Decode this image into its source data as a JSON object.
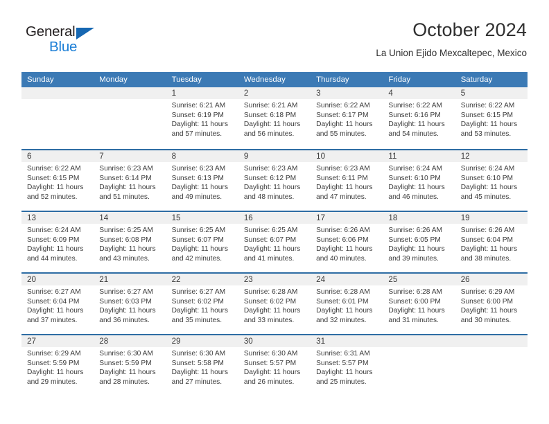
{
  "brand": {
    "name_top": "General",
    "name_bottom": "Blue",
    "accent_color": "#1b7ed6",
    "triangle_color": "#1667b2"
  },
  "header": {
    "title": "October 2024",
    "subtitle": "La Union Ejido Mexcaltepec, Mexico"
  },
  "theme": {
    "header_blue": "#3c7ab5",
    "row_divider_blue": "#2e6da4",
    "daynum_band": "#f0f0f0",
    "text": "#3b3b3b"
  },
  "weekdays": [
    "Sunday",
    "Monday",
    "Tuesday",
    "Wednesday",
    "Thursday",
    "Friday",
    "Saturday"
  ],
  "weeks": [
    [
      {
        "day": "",
        "sunrise": "",
        "sunset": "",
        "daylight": ""
      },
      {
        "day": "",
        "sunrise": "",
        "sunset": "",
        "daylight": ""
      },
      {
        "day": "1",
        "sunrise": "Sunrise: 6:21 AM",
        "sunset": "Sunset: 6:19 PM",
        "daylight": "Daylight: 11 hours and 57 minutes."
      },
      {
        "day": "2",
        "sunrise": "Sunrise: 6:21 AM",
        "sunset": "Sunset: 6:18 PM",
        "daylight": "Daylight: 11 hours and 56 minutes."
      },
      {
        "day": "3",
        "sunrise": "Sunrise: 6:22 AM",
        "sunset": "Sunset: 6:17 PM",
        "daylight": "Daylight: 11 hours and 55 minutes."
      },
      {
        "day": "4",
        "sunrise": "Sunrise: 6:22 AM",
        "sunset": "Sunset: 6:16 PM",
        "daylight": "Daylight: 11 hours and 54 minutes."
      },
      {
        "day": "5",
        "sunrise": "Sunrise: 6:22 AM",
        "sunset": "Sunset: 6:15 PM",
        "daylight": "Daylight: 11 hours and 53 minutes."
      }
    ],
    [
      {
        "day": "6",
        "sunrise": "Sunrise: 6:22 AM",
        "sunset": "Sunset: 6:15 PM",
        "daylight": "Daylight: 11 hours and 52 minutes."
      },
      {
        "day": "7",
        "sunrise": "Sunrise: 6:23 AM",
        "sunset": "Sunset: 6:14 PM",
        "daylight": "Daylight: 11 hours and 51 minutes."
      },
      {
        "day": "8",
        "sunrise": "Sunrise: 6:23 AM",
        "sunset": "Sunset: 6:13 PM",
        "daylight": "Daylight: 11 hours and 49 minutes."
      },
      {
        "day": "9",
        "sunrise": "Sunrise: 6:23 AM",
        "sunset": "Sunset: 6:12 PM",
        "daylight": "Daylight: 11 hours and 48 minutes."
      },
      {
        "day": "10",
        "sunrise": "Sunrise: 6:23 AM",
        "sunset": "Sunset: 6:11 PM",
        "daylight": "Daylight: 11 hours and 47 minutes."
      },
      {
        "day": "11",
        "sunrise": "Sunrise: 6:24 AM",
        "sunset": "Sunset: 6:10 PM",
        "daylight": "Daylight: 11 hours and 46 minutes."
      },
      {
        "day": "12",
        "sunrise": "Sunrise: 6:24 AM",
        "sunset": "Sunset: 6:10 PM",
        "daylight": "Daylight: 11 hours and 45 minutes."
      }
    ],
    [
      {
        "day": "13",
        "sunrise": "Sunrise: 6:24 AM",
        "sunset": "Sunset: 6:09 PM",
        "daylight": "Daylight: 11 hours and 44 minutes."
      },
      {
        "day": "14",
        "sunrise": "Sunrise: 6:25 AM",
        "sunset": "Sunset: 6:08 PM",
        "daylight": "Daylight: 11 hours and 43 minutes."
      },
      {
        "day": "15",
        "sunrise": "Sunrise: 6:25 AM",
        "sunset": "Sunset: 6:07 PM",
        "daylight": "Daylight: 11 hours and 42 minutes."
      },
      {
        "day": "16",
        "sunrise": "Sunrise: 6:25 AM",
        "sunset": "Sunset: 6:07 PM",
        "daylight": "Daylight: 11 hours and 41 minutes."
      },
      {
        "day": "17",
        "sunrise": "Sunrise: 6:26 AM",
        "sunset": "Sunset: 6:06 PM",
        "daylight": "Daylight: 11 hours and 40 minutes."
      },
      {
        "day": "18",
        "sunrise": "Sunrise: 6:26 AM",
        "sunset": "Sunset: 6:05 PM",
        "daylight": "Daylight: 11 hours and 39 minutes."
      },
      {
        "day": "19",
        "sunrise": "Sunrise: 6:26 AM",
        "sunset": "Sunset: 6:04 PM",
        "daylight": "Daylight: 11 hours and 38 minutes."
      }
    ],
    [
      {
        "day": "20",
        "sunrise": "Sunrise: 6:27 AM",
        "sunset": "Sunset: 6:04 PM",
        "daylight": "Daylight: 11 hours and 37 minutes."
      },
      {
        "day": "21",
        "sunrise": "Sunrise: 6:27 AM",
        "sunset": "Sunset: 6:03 PM",
        "daylight": "Daylight: 11 hours and 36 minutes."
      },
      {
        "day": "22",
        "sunrise": "Sunrise: 6:27 AM",
        "sunset": "Sunset: 6:02 PM",
        "daylight": "Daylight: 11 hours and 35 minutes."
      },
      {
        "day": "23",
        "sunrise": "Sunrise: 6:28 AM",
        "sunset": "Sunset: 6:02 PM",
        "daylight": "Daylight: 11 hours and 33 minutes."
      },
      {
        "day": "24",
        "sunrise": "Sunrise: 6:28 AM",
        "sunset": "Sunset: 6:01 PM",
        "daylight": "Daylight: 11 hours and 32 minutes."
      },
      {
        "day": "25",
        "sunrise": "Sunrise: 6:28 AM",
        "sunset": "Sunset: 6:00 PM",
        "daylight": "Daylight: 11 hours and 31 minutes."
      },
      {
        "day": "26",
        "sunrise": "Sunrise: 6:29 AM",
        "sunset": "Sunset: 6:00 PM",
        "daylight": "Daylight: 11 hours and 30 minutes."
      }
    ],
    [
      {
        "day": "27",
        "sunrise": "Sunrise: 6:29 AM",
        "sunset": "Sunset: 5:59 PM",
        "daylight": "Daylight: 11 hours and 29 minutes."
      },
      {
        "day": "28",
        "sunrise": "Sunrise: 6:30 AM",
        "sunset": "Sunset: 5:59 PM",
        "daylight": "Daylight: 11 hours and 28 minutes."
      },
      {
        "day": "29",
        "sunrise": "Sunrise: 6:30 AM",
        "sunset": "Sunset: 5:58 PM",
        "daylight": "Daylight: 11 hours and 27 minutes."
      },
      {
        "day": "30",
        "sunrise": "Sunrise: 6:30 AM",
        "sunset": "Sunset: 5:57 PM",
        "daylight": "Daylight: 11 hours and 26 minutes."
      },
      {
        "day": "31",
        "sunrise": "Sunrise: 6:31 AM",
        "sunset": "Sunset: 5:57 PM",
        "daylight": "Daylight: 11 hours and 25 minutes."
      },
      {
        "day": "",
        "sunrise": "",
        "sunset": "",
        "daylight": ""
      },
      {
        "day": "",
        "sunrise": "",
        "sunset": "",
        "daylight": ""
      }
    ]
  ]
}
